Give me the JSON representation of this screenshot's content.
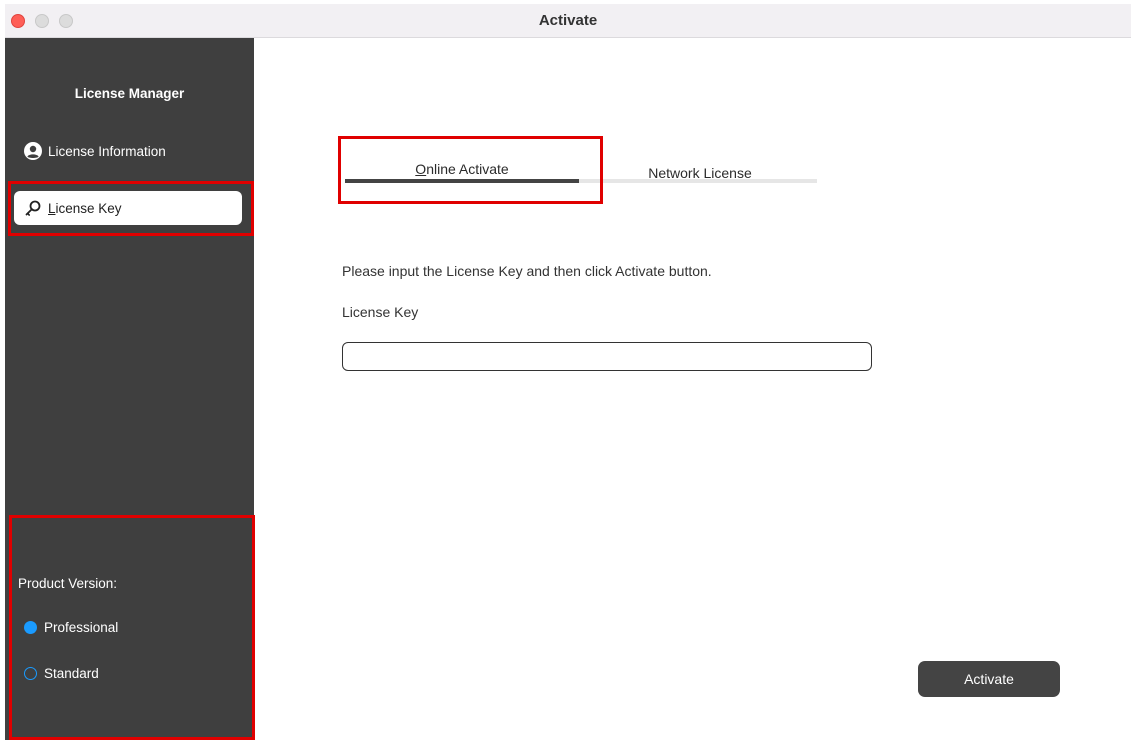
{
  "window": {
    "title": "Activate"
  },
  "sidebar": {
    "heading": "License Manager",
    "items": [
      {
        "label": "License Information",
        "icon": "user-circle-icon",
        "selected": false
      },
      {
        "label_access_key": "L",
        "label_rest": "icense Key",
        "icon": "key-icon",
        "selected": true
      }
    ],
    "product_version": {
      "label": "Product Version:",
      "options": [
        {
          "label": "Professional",
          "checked": true
        },
        {
          "label": "Standard",
          "checked": false
        }
      ]
    }
  },
  "main": {
    "tabs": [
      {
        "access_key": "O",
        "rest": "nline Activate",
        "active": true
      },
      {
        "access_key": "N",
        "rest": "etwork License",
        "active": false
      }
    ],
    "instruction": "Please input the License Key and then click Activate button.",
    "license_key_label": "License Key",
    "license_key_value": "",
    "activate_button": "Activate"
  },
  "colors": {
    "sidebar_bg": "#3f3f3f",
    "accent_radio": "#1a9bff",
    "button_bg": "#444444",
    "highlight_box": "#e00000",
    "close_button": "#fe5f57"
  }
}
